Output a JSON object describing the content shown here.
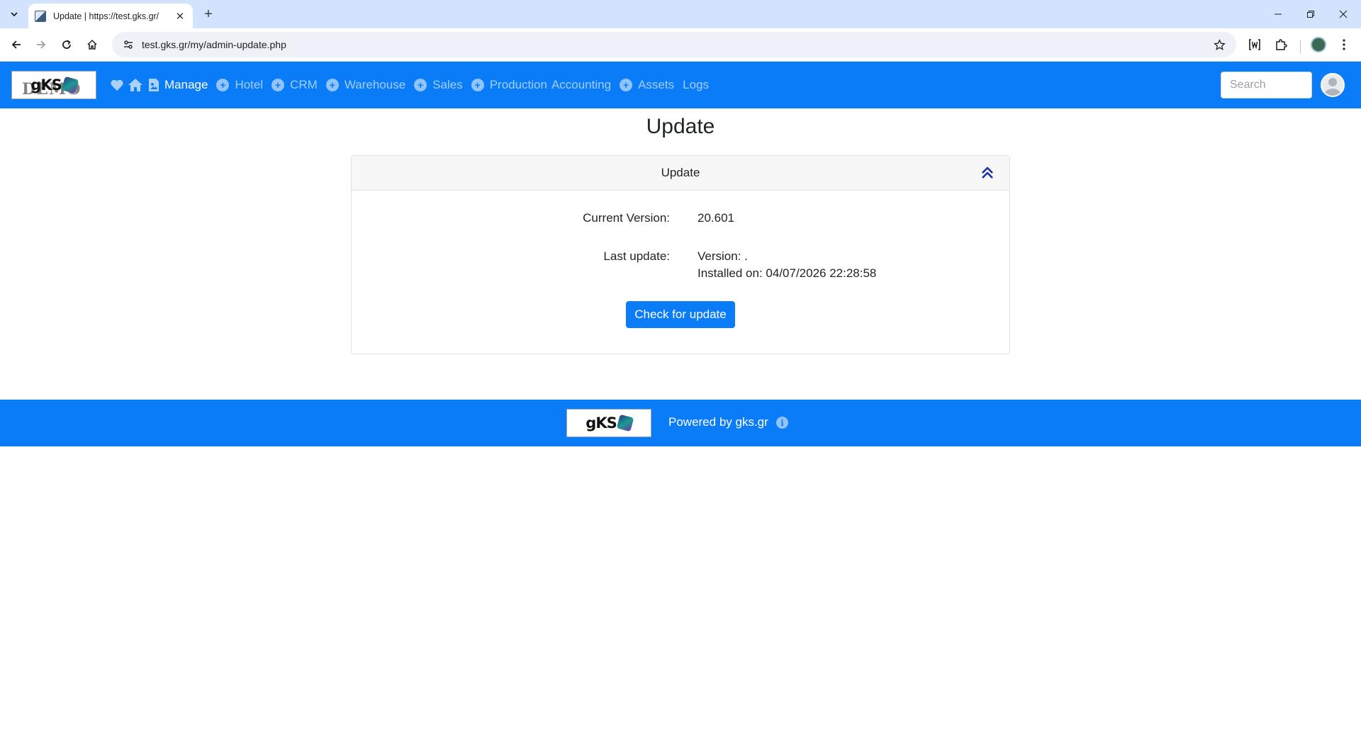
{
  "browser": {
    "tab_title": "Update | https://test.gks.gr/",
    "url": "test.gks.gr/my/admin-update.php",
    "new_tab_symbol": "+",
    "close_symbol": "✕"
  },
  "navbar": {
    "logo_text": "gKS",
    "logo_watermark": "DEMO",
    "menu": [
      {
        "label": "Manage",
        "active": true,
        "has_plus": false
      },
      {
        "label": "Hotel",
        "active": false,
        "has_plus": true
      },
      {
        "label": "CRM",
        "active": false,
        "has_plus": true
      },
      {
        "label": "Warehouse",
        "active": false,
        "has_plus": true
      },
      {
        "label": "Sales",
        "active": false,
        "has_plus": true
      },
      {
        "label": "Production",
        "active": false,
        "has_plus": true
      },
      {
        "label": "Accounting",
        "active": false,
        "has_plus": false
      },
      {
        "label": "Assets",
        "active": false,
        "has_plus": true
      },
      {
        "label": "Logs",
        "active": false,
        "has_plus": false
      }
    ],
    "search_placeholder": "Search"
  },
  "main": {
    "page_title": "Update",
    "card_title": "Update",
    "current_version_label": "Current Version:",
    "current_version_value": "20.601",
    "last_update_label": "Last update:",
    "last_update_version": "Version: .",
    "last_update_installed": "Installed on: 04/07/2026 22:28:58",
    "check_button": "Check for update"
  },
  "footer": {
    "logo_text": "gKS",
    "powered_by": "Powered by gks.gr"
  },
  "colors": {
    "brand_blue": "#0a7cf7",
    "chrome_tabstrip": "#d3e3fd",
    "collapse_icon": "#1a2fa0"
  }
}
